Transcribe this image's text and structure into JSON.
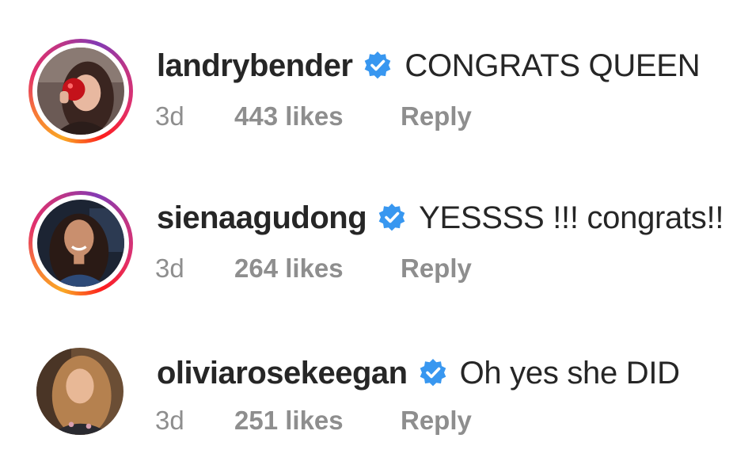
{
  "comments": [
    {
      "username": "landrybender",
      "text": "CONGRATS QUEEN",
      "time": "3d",
      "likes": "443 likes",
      "reply": "Reply",
      "has_story_ring": true
    },
    {
      "username": "sienaagudong",
      "text": "YESSSS !!! congrats!!",
      "time": "3d",
      "likes": "264 likes",
      "reply": "Reply",
      "has_story_ring": true
    },
    {
      "username": "oliviarosekeegan",
      "text": "Oh yes she DID",
      "time": "3d",
      "likes": "251 likes",
      "reply": "Reply",
      "has_story_ring": false
    }
  ],
  "colors": {
    "text": "#262626",
    "meta": "#8e8e8e",
    "verified": "#3897f0"
  },
  "icons": {
    "verified": "verified-badge-icon"
  }
}
